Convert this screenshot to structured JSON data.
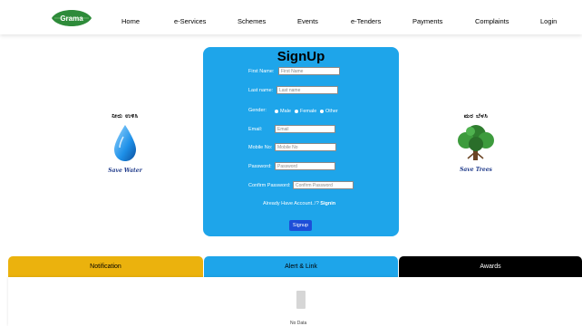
{
  "navbar": {
    "logo_text": "Grama",
    "items": [
      "Home",
      "e-Services",
      "Schemes",
      "Events",
      "e-Tenders",
      "Payments",
      "Complaints",
      "Login"
    ]
  },
  "left_graphic": {
    "kannada": "ನೀರು ಉಳಿಸಿ",
    "tagline": "Save Water"
  },
  "right_graphic": {
    "kannada": "ಮರ ಬೆಳಸಿ",
    "tagline": "Save Trees"
  },
  "form": {
    "title": "SignUp",
    "first_name": {
      "label": "First Name:",
      "placeholder": "First Name"
    },
    "last_name": {
      "label": "Last name:",
      "placeholder": "Last name"
    },
    "gender": {
      "label": "Gender:",
      "options": [
        "Male",
        "Female",
        "Other"
      ]
    },
    "email": {
      "label": "Email:",
      "placeholder": "Email"
    },
    "mobile": {
      "label": "Mobile No:",
      "placeholder": "Mobile No"
    },
    "password": {
      "label": "Password:",
      "placeholder": "Password"
    },
    "confirm_password": {
      "label": "Confirm Password:",
      "placeholder": "Confirm Password"
    },
    "already_text": "Already Have Account..!?",
    "signin_label": "Signin",
    "submit_label": "Signup"
  },
  "tabs": [
    "Notification",
    "Alert & Link",
    "Awards"
  ],
  "empty_state": {
    "text": "No Data"
  },
  "colors": {
    "card_blue": "#1ea5ea",
    "button_blue": "#1d4ed8",
    "tab_yellow": "#ebb20d",
    "tab_black": "#000000",
    "logo_green": "#2e8b3a",
    "tagline_blue": "#1f3a8a"
  },
  "icons": [
    "leaf-logo-icon",
    "water-drop-icon",
    "tree-icon",
    "document-icon"
  ]
}
